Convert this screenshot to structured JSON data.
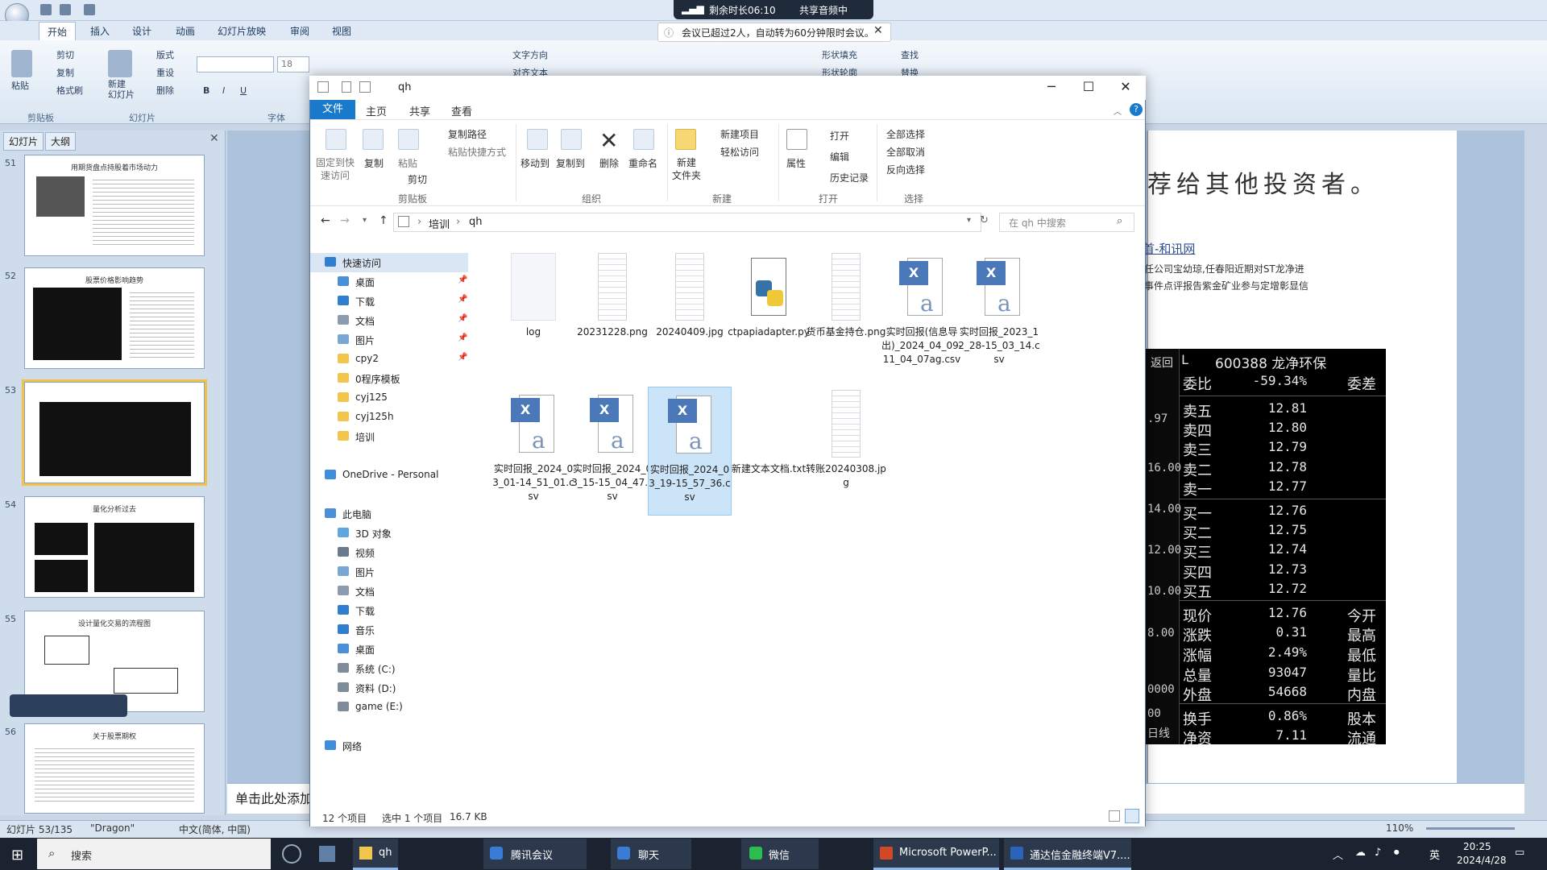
{
  "ppt": {
    "tabs": [
      "开始",
      "插入",
      "设计",
      "动画",
      "幻灯片放映",
      "审阅",
      "视图"
    ],
    "ribbon": {
      "paste": "粘贴",
      "cut": "剪切",
      "copy": "复制",
      "format_painter": "格式刷",
      "new_slide": "新建\n幻灯片",
      "layout": "版式",
      "reset": "重设",
      "delete": "删除",
      "font_size": "18",
      "text_direction": "文字方向",
      "align_text": "对齐文本",
      "shape_fill": "形状填充",
      "shape_outline": "形状轮廓",
      "find": "查找",
      "replace": "替换",
      "group_clipboard": "剪贴板",
      "group_slides": "幻灯片",
      "group_font": "字体"
    },
    "panel_tabs": [
      "幻灯片",
      "大纲"
    ],
    "slides": [
      {
        "num": "51",
        "title": "用期货盘点持股着市场动力"
      },
      {
        "num": "52",
        "title": "股票价格影响趋势"
      },
      {
        "num": "53",
        "title": ""
      },
      {
        "num": "54",
        "title": "量化分析过去"
      },
      {
        "num": "55",
        "title": "设计量化交易的流程图"
      },
      {
        "num": "56",
        "title": "关于股票期权"
      }
    ],
    "slide_title": "荐给其他投资者。",
    "slide_link": "首-和讯网",
    "slide_text1": "任公司宝幼琼,任春阳近期对ST龙净进",
    "slide_text2": "事件点评报告紫金矿业参与定增彰显信",
    "notes_placeholder": "单击此处添加",
    "status": {
      "slide_pos": "幻灯片 53/135",
      "theme": "\"Dragon\"",
      "lang": "中文(简体, 中国)",
      "zoom": "110%"
    }
  },
  "meeting": {
    "remaining": "剩余时长06:10",
    "sharing": "共享音频中",
    "notice": "会议已超过2人，自动转为60分钟限时会议。"
  },
  "stock": {
    "back": "返回",
    "code_prefix": "L",
    "code": "600388 龙净环保",
    "left_ticks": [
      ".97",
      "16.00",
      "14.00",
      "12.00",
      "10.00",
      "8.00",
      "0000",
      "00",
      "日线"
    ],
    "rows": [
      {
        "label": "委比",
        "value": "-59.34%",
        "label2": "委差"
      },
      {
        "label": "卖五",
        "value": "12.81",
        "label2": ""
      },
      {
        "label": "卖四",
        "value": "12.80",
        "label2": ""
      },
      {
        "label": "卖三",
        "value": "12.79",
        "label2": ""
      },
      {
        "label": "卖二",
        "value": "12.78",
        "label2": ""
      },
      {
        "label": "卖一",
        "value": "12.77",
        "label2": ""
      },
      {
        "label": "买一",
        "value": "12.76",
        "label2": ""
      },
      {
        "label": "买二",
        "value": "12.75",
        "label2": ""
      },
      {
        "label": "买三",
        "value": "12.74",
        "label2": ""
      },
      {
        "label": "买四",
        "value": "12.73",
        "label2": ""
      },
      {
        "label": "买五",
        "value": "12.72",
        "label2": ""
      },
      {
        "label": "现价",
        "value": "12.76",
        "label2": "今开"
      },
      {
        "label": "涨跌",
        "value": "0.31",
        "label2": "最高"
      },
      {
        "label": "涨幅",
        "value": "2.49%",
        "label2": "最低"
      },
      {
        "label": "总量",
        "value": "93047",
        "label2": "量比"
      },
      {
        "label": "外盘",
        "value": "54668",
        "label2": "内盘"
      },
      {
        "label": "换手",
        "value": "0.86%",
        "label2": "股本"
      },
      {
        "label": "净资",
        "value": "7.11",
        "label2": "流通"
      }
    ]
  },
  "explorer": {
    "title": "qh",
    "tabs": {
      "file": "文件",
      "home": "主页",
      "share": "共享",
      "view": "查看"
    },
    "ribbon": {
      "pin": "固定到快\n速访问",
      "copy": "复制",
      "paste": "粘贴",
      "copy_path": "复制路径",
      "paste_shortcut": "粘贴快捷方式",
      "cut": "剪切",
      "move_to": "移动到",
      "copy_to": "复制到",
      "delete": "删除",
      "rename": "重命名",
      "new_folder": "新建\n文件夹",
      "new_item": "新建项目",
      "easy_access": "轻松访问",
      "properties": "属性",
      "open": "打开",
      "edit": "编辑",
      "history": "历史记录",
      "select_all": "全部选择",
      "select_none": "全部取消",
      "invert_selection": "反向选择",
      "groups": [
        "剪贴板",
        "组织",
        "新建",
        "打开",
        "选择"
      ]
    },
    "address": [
      "培训",
      "qh"
    ],
    "search_placeholder": "在 qh 中搜索",
    "nav": [
      {
        "label": "快速访问",
        "icon": "star-icon",
        "indent": 0,
        "pin": false,
        "sel": true
      },
      {
        "label": "桌面",
        "icon": "desktop-icon",
        "indent": 1,
        "pin": true
      },
      {
        "label": "下载",
        "icon": "download-icon",
        "indent": 1,
        "pin": true
      },
      {
        "label": "文档",
        "icon": "document-icon",
        "indent": 1,
        "pin": true
      },
      {
        "label": "图片",
        "icon": "picture-icon",
        "indent": 1,
        "pin": true
      },
      {
        "label": "cpy2",
        "icon": "folder-icon",
        "indent": 1,
        "pin": true
      },
      {
        "label": "0程序模板",
        "icon": "folder-icon",
        "indent": 1,
        "pin": false
      },
      {
        "label": "cyj125",
        "icon": "folder-icon",
        "indent": 1,
        "pin": false
      },
      {
        "label": "cyj125h",
        "icon": "folder-icon",
        "indent": 1,
        "pin": false
      },
      {
        "label": "培训",
        "icon": "folder-icon",
        "indent": 1,
        "pin": false
      },
      {
        "label": "",
        "icon": "",
        "indent": 0,
        "pin": false
      },
      {
        "label": "OneDrive - Personal",
        "icon": "cloud-icon",
        "indent": 0,
        "pin": false
      },
      {
        "label": "",
        "icon": "",
        "indent": 0,
        "pin": false
      },
      {
        "label": "此电脑",
        "icon": "computer-icon",
        "indent": 0,
        "pin": false
      },
      {
        "label": "3D 对象",
        "icon": "cube-icon",
        "indent": 1,
        "pin": false
      },
      {
        "label": "视频",
        "icon": "video-icon",
        "indent": 1,
        "pin": false
      },
      {
        "label": "图片",
        "icon": "picture-icon",
        "indent": 1,
        "pin": false
      },
      {
        "label": "文档",
        "icon": "document-icon",
        "indent": 1,
        "pin": false
      },
      {
        "label": "下载",
        "icon": "download-icon",
        "indent": 1,
        "pin": false
      },
      {
        "label": "音乐",
        "icon": "music-icon",
        "indent": 1,
        "pin": false
      },
      {
        "label": "桌面",
        "icon": "desktop-icon",
        "indent": 1,
        "pin": false
      },
      {
        "label": "系统 (C:)",
        "icon": "drive-icon",
        "indent": 1,
        "pin": false
      },
      {
        "label": "资料 (D:)",
        "icon": "drive-icon",
        "indent": 1,
        "pin": false
      },
      {
        "label": "game (E:)",
        "icon": "drive-icon",
        "indent": 1,
        "pin": false
      },
      {
        "label": "",
        "icon": "",
        "indent": 0,
        "pin": false
      },
      {
        "label": "网络",
        "icon": "network-icon",
        "indent": 0,
        "pin": false
      }
    ],
    "files": [
      {
        "name": "log",
        "type": "folder"
      },
      {
        "name": "20231228.png",
        "type": "image"
      },
      {
        "name": "20240409.jpg",
        "type": "image"
      },
      {
        "name": "ctpapiadapter.py",
        "type": "python"
      },
      {
        "name": "货币基金持仓.png",
        "type": "image"
      },
      {
        "name": "实时回报(信息导出)_2024_04_09-11_04_07ag.csv",
        "type": "csv"
      },
      {
        "name": "实时回报_2023_12_28-15_03_14.csv",
        "type": "csv"
      },
      {
        "name": "实时回报_2024_03_01-14_51_01.csv",
        "type": "csv"
      },
      {
        "name": "实时回报_2024_03_15-15_04_47.csv",
        "type": "csv"
      },
      {
        "name": "实时回报_2024_03_19-15_57_36.csv",
        "type": "csv",
        "selected": true
      },
      {
        "name": "新建文本文档.txt",
        "type": "text"
      },
      {
        "name": "转账20240308.jpg",
        "type": "image"
      }
    ],
    "status": {
      "count": "12 个项目",
      "selected": "选中 1 个项目",
      "size": "16.7 KB"
    }
  },
  "taskbar": {
    "search": "搜索",
    "apps": [
      "qh",
      "腾讯会议",
      "聊天",
      "微信",
      "Microsoft PowerP...",
      "通达信金融终端V7...."
    ],
    "ime": "英",
    "time": "20:25",
    "date": "2024/4/28"
  },
  "colors": {
    "accent": "#1979ca",
    "selection": "#cce4f7",
    "taskbar": "#1b2330"
  }
}
